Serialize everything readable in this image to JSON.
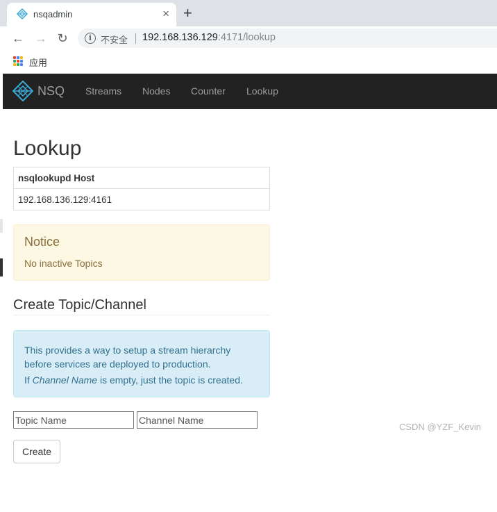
{
  "browser": {
    "tab_title": "nsqadmin",
    "tab_close": "×",
    "new_tab": "+",
    "back": "←",
    "forward": "→",
    "reload": "↻",
    "security_label": "不安全",
    "url_host": "192.168.136.129",
    "url_rest": ":4171/lookup",
    "bookmark_apps_label": "应用"
  },
  "nav": {
    "brand": "NSQ",
    "links": [
      "Streams",
      "Nodes",
      "Counter",
      "Lookup"
    ]
  },
  "main": {
    "title": "Lookup",
    "host_table": {
      "header": "nsqlookupd Host",
      "rows": [
        "192.168.136.129:4161"
      ]
    },
    "notice": {
      "title": "Notice",
      "text": "No inactive Topics"
    },
    "create_section": {
      "title": "Create Topic/Channel",
      "info_line1": "This provides a way to setup a stream hierarchy before services are deployed to production.",
      "info_line2_prefix": "If ",
      "info_line2_em": "Channel Name",
      "info_line2_suffix": " is empty, just the topic is created.",
      "topic_placeholder": "Topic Name",
      "channel_placeholder": "Channel Name",
      "create_label": "Create"
    }
  },
  "watermark": "CSDN @YZF_Kevin",
  "colors": {
    "navbar_bg": "#222222",
    "nav_text": "#9d9d9d",
    "logo_accent": "#3aa9d8",
    "notice_bg": "#fcf8e3",
    "info_bg": "#d9edf7"
  }
}
